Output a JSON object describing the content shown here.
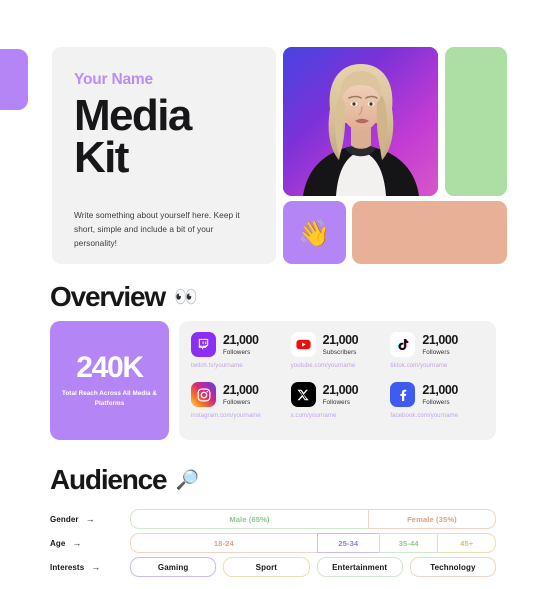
{
  "hero": {
    "eyebrow": "Your Name",
    "title": "Media Kit",
    "bio": "Write something about yourself here. Keep it short, simple and include a bit of your personality!",
    "wave_emoji": "👋",
    "colors": {
      "accent_purple": "#b485f5",
      "eyebrow_purple": "#bb8dfb",
      "card_bg": "#f2f2f2",
      "green": "#addfa5",
      "peach": "#e8b197",
      "heading": "#17171a"
    }
  },
  "overview": {
    "heading": "Overview",
    "heading_emoji": "👀",
    "total_reach": {
      "value": "240K",
      "caption": "Total Reach Across All Media & Platforms"
    },
    "platforms": [
      {
        "icon": "twitch-icon",
        "count": "21,000",
        "label": "Followers",
        "url": "twitch.tv/yourname"
      },
      {
        "icon": "youtube-icon",
        "count": "21,000",
        "label": "Subscribers",
        "url": "youtube.com/yourname"
      },
      {
        "icon": "tiktok-icon",
        "count": "21,000",
        "label": "Followers",
        "url": "tiktok.com/yourname"
      },
      {
        "icon": "instagram-icon",
        "count": "21,000",
        "label": "Followers",
        "url": "instagram.com/yourname"
      },
      {
        "icon": "x-icon",
        "count": "21,000",
        "label": "Followers",
        "url": "x.com/yourname"
      },
      {
        "icon": "facebook-icon",
        "count": "21,000",
        "label": "Followers",
        "url": "facebook.com/yourname"
      }
    ]
  },
  "audience": {
    "heading": "Audience",
    "heading_emoji": "🔎",
    "arrow": "→",
    "rows": [
      {
        "label": "Gender",
        "segments": [
          {
            "text": "Male (65%)",
            "width_pct": 65,
            "color": "#8ec98a",
            "border": "#cfe9cc"
          },
          {
            "text": "Female (35%)",
            "width_pct": 35,
            "color": "#dfa286",
            "border": "#f1d4c6"
          }
        ]
      },
      {
        "label": "Age",
        "segments": [
          {
            "text": "18-24",
            "width_pct": 51,
            "color": "#dfa286",
            "border": "#f1d4c6"
          },
          {
            "text": "25-34",
            "width_pct": 17,
            "color": "#9a7ae0",
            "border": "#cbbcf0"
          },
          {
            "text": "35-44",
            "width_pct": 16,
            "color": "#8ec98a",
            "border": "#cfe9cc"
          },
          {
            "text": "45+",
            "width_pct": 16,
            "color": "#d9c07a",
            "border": "#ecdfb6"
          }
        ]
      }
    ],
    "interests": {
      "label": "Interests",
      "chips": [
        {
          "text": "Gaming",
          "border": "#cbbcf0"
        },
        {
          "text": "Sport",
          "border": "#ecdfb6"
        },
        {
          "text": "Entertainment",
          "border": "#cfe9cc"
        },
        {
          "text": "Technology",
          "border": "#f1d4c6"
        }
      ]
    }
  }
}
